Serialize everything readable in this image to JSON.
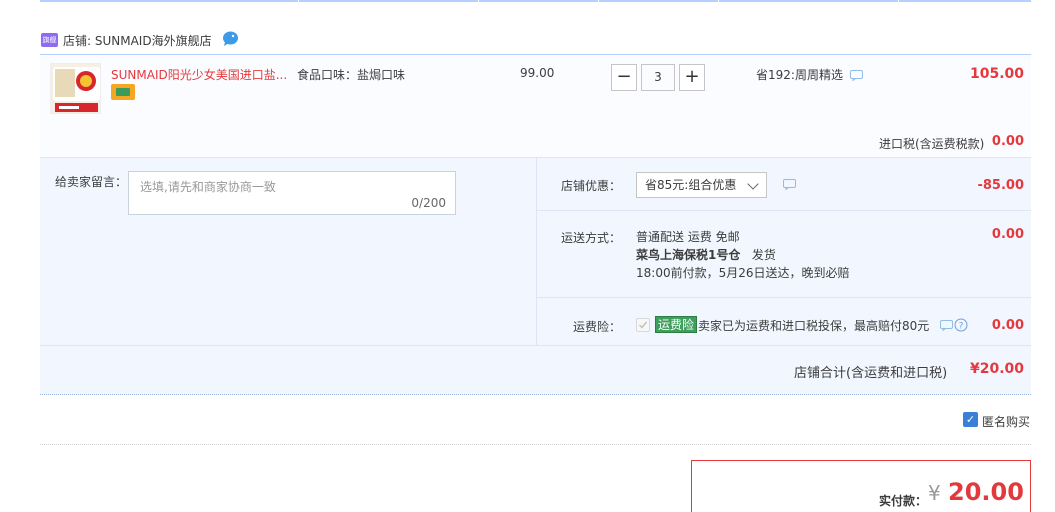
{
  "shop": {
    "tag": "旗舰",
    "name": "店铺: SUNMAID海外旗舰店"
  },
  "item": {
    "title": "SUNMAID阳光少女美国进口盐...",
    "sku": "食品口味：盐焗口味",
    "price": "99.00",
    "quantity": "3",
    "minus": "−",
    "plus": "+",
    "promo": "省192:周周精选",
    "subtotal": "105.00",
    "tax_label": "进口税(含运费税款)",
    "tax_value": "0.00"
  },
  "message": {
    "label": "给卖家留言：",
    "placeholder": "选填,请先和商家协商一致",
    "count": "0/200"
  },
  "discount": {
    "label": "店铺优惠：",
    "selected": "省85元:组合优惠",
    "value": "-85.00"
  },
  "shipping": {
    "label": "运送方式：",
    "line1": "普通配送 运费 免邮",
    "line2_bold": "菜鸟上海保税1号仓",
    "line2_rest": "发货",
    "line3": "18:00前付款，5月26日送达，晚到必赔",
    "value": "0.00"
  },
  "insurance": {
    "label": "运费险：",
    "tag": "运费险",
    "text": "卖家已为运费和进口税投保，最高赔付80元",
    "value": "0.00"
  },
  "shop_total": {
    "label": "店铺合计(含运费和进口税)",
    "value": "¥20.00"
  },
  "anonymous": {
    "label": "匿名购买",
    "checked": true
  },
  "payment": {
    "label": "实付款：",
    "currency": "¥",
    "value": "20.00"
  },
  "colors": {
    "accent_red": "#e4393c",
    "panel_bg": "#f2f7ff",
    "border_blue": "#b2d1ff",
    "check_blue": "#3c7fd6",
    "insure_green": "#3e9f5d"
  }
}
